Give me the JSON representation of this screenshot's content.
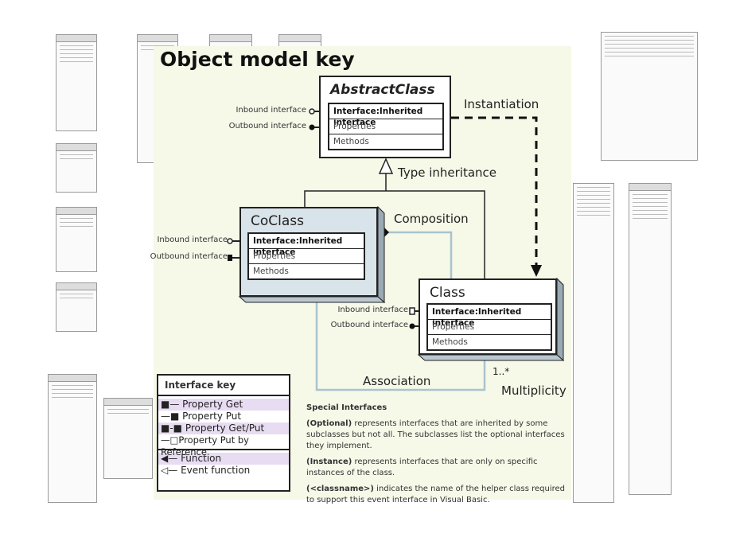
{
  "title": "Object model key",
  "classes": {
    "abstract": {
      "name": "AbstractClass",
      "interface": "Interface:Inherited interface",
      "properties": "Properties",
      "methods": "Methods"
    },
    "coclass": {
      "name": "CoClass",
      "interface": "Interface:Inherited interface",
      "properties": "Properties",
      "methods": "Methods"
    },
    "class": {
      "name": "Class",
      "interface": "Interface:Inherited interface",
      "properties": "Properties",
      "methods": "Methods"
    }
  },
  "labels": {
    "inbound": "Inbound interface",
    "outbound": "Outbound interface"
  },
  "relations": {
    "instantiation": "Instantiation",
    "type_inheritance": "Type inheritance",
    "composition": "Composition",
    "association": "Association",
    "multiplicity_value": "1..*",
    "multiplicity": "Multiplicity"
  },
  "interface_key": {
    "title": "Interface key",
    "items": [
      {
        "label": "Property Get",
        "icon": "property-get-icon"
      },
      {
        "label": "Property Put",
        "icon": "property-put-icon"
      },
      {
        "label": "Property Get/Put",
        "icon": "property-get-put-icon"
      },
      {
        "label": "Property Put by Reference",
        "icon": "property-put-by-ref-icon"
      },
      {
        "label": "Function",
        "icon": "function-arrow-icon"
      },
      {
        "label": "Event function",
        "icon": "event-function-icon"
      }
    ]
  },
  "special": {
    "title": "Special Interfaces",
    "optional_term": "(Optional)",
    "optional_text": " represents interfaces that are inherited by some subclasses but not all. The subclasses list the optional interfaces they implement.",
    "instance_term": "(Instance)",
    "instance_text": " represents interfaces that are only on specific instances of the class.",
    "classname_term": "(<classname>)",
    "classname_text": " indicates the name of the helper class required to support this event interface in Visual Basic."
  },
  "colors": {
    "panel": "#f6f8e8",
    "coclass_fill": "#d9e3ea",
    "association_line": "#a9c4cc",
    "key_highlight": "#e8dcf2"
  }
}
